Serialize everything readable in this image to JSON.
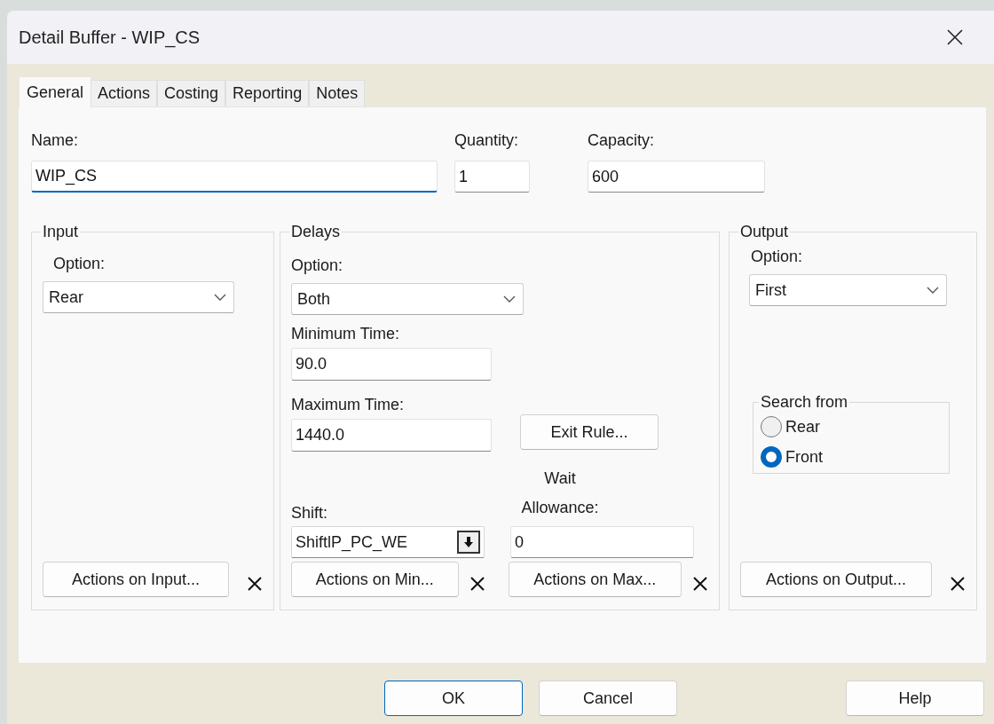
{
  "window": {
    "title": "Detail Buffer - WIP_CS"
  },
  "tabs": [
    {
      "label": "General",
      "selected": true
    },
    {
      "label": "Actions",
      "selected": false
    },
    {
      "label": "Costing",
      "selected": false
    },
    {
      "label": "Reporting",
      "selected": false
    },
    {
      "label": "Notes",
      "selected": false
    }
  ],
  "name": {
    "label": "Name:",
    "value": "WIP_CS",
    "focused": true
  },
  "quantity": {
    "label": "Quantity:",
    "value": "1"
  },
  "capacity": {
    "label": "Capacity:",
    "value": "600"
  },
  "input": {
    "title": "Input",
    "option": {
      "label": "Option:",
      "value": "Rear"
    },
    "actions_button": "Actions on Input..."
  },
  "delays": {
    "title": "Delays",
    "option": {
      "label": "Option:",
      "value": "Both"
    },
    "minimum_time": {
      "label": "Minimum Time:",
      "value": "90.0"
    },
    "maximum_time": {
      "label": "Maximum Time:",
      "value": "1440.0"
    },
    "exit_rule_button": "Exit Rule...",
    "shift": {
      "label": "Shift:",
      "value": "ShiftlP_PC_WE"
    },
    "wait_allowance": {
      "label": "Wait Allowance:",
      "value": "0"
    },
    "actions_min_button": "Actions on Min...",
    "actions_max_button": "Actions on Max..."
  },
  "output": {
    "title": "Output",
    "option": {
      "label": "Option:",
      "value": "First"
    },
    "search_from": {
      "title": "Search from",
      "options": [
        {
          "label": "Rear",
          "selected": false
        },
        {
          "label": "Front",
          "selected": true
        }
      ]
    },
    "actions_button": "Actions on Output..."
  },
  "footer": {
    "buttons": [
      {
        "label": "OK",
        "default": true
      },
      {
        "label": "Cancel",
        "default": false
      }
    ],
    "help_button": "Help"
  }
}
